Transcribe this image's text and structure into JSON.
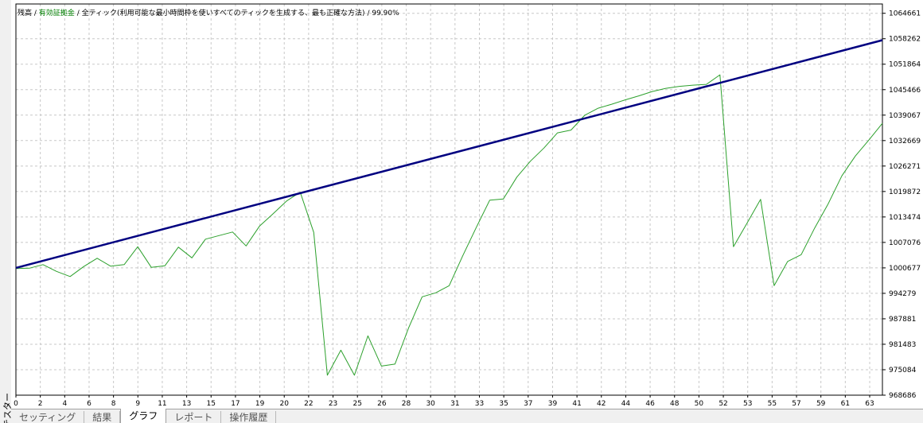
{
  "side_label": "テスター",
  "legend": {
    "balance_label": "残高",
    "separator": " / ",
    "equity_label": "有効証拠金",
    "model_text": "全ティック(利用可能な最小時間枠を使いすべてのティックを生成する、最も正確な方法)",
    "quality_text": "99.90%"
  },
  "tabs": [
    {
      "label": "セッティング"
    },
    {
      "label": "結果"
    },
    {
      "label": "グラフ"
    },
    {
      "label": "レポート"
    },
    {
      "label": "操作履歴"
    }
  ],
  "colors": {
    "balance": "#000080",
    "equity": "#2ca02c",
    "grid": "#c8c8c8",
    "legend_text": "#000000",
    "equity_text": "#008000"
  },
  "chart_data": {
    "type": "line",
    "xlim": [
      0,
      64
    ],
    "ylim": [
      968686,
      1067000
    ],
    "x_ticks": [
      "0",
      "2",
      "4",
      "6",
      "8",
      "9",
      "11",
      "13",
      "15",
      "17",
      "19",
      "20",
      "22",
      "23",
      "25",
      "26",
      "28",
      "30",
      "31",
      "33",
      "35",
      "37",
      "39",
      "41",
      "42",
      "44",
      "46",
      "48",
      "50",
      "52",
      "53",
      "55",
      "57",
      "59",
      "61",
      "63"
    ],
    "y_ticks": [
      1064661,
      1058262,
      1051864,
      1045466,
      1039067,
      1032669,
      1026271,
      1019872,
      1013474,
      1007076,
      1000677,
      994279,
      987881,
      981483,
      975084,
      968686
    ],
    "series": [
      {
        "name": "残高",
        "x": [
          0,
          64
        ],
        "y": [
          1000677,
          1057900
        ]
      },
      {
        "name": "有効証拠金",
        "x": [
          0,
          1,
          2,
          3,
          4,
          5,
          6,
          7,
          8,
          9,
          10,
          11,
          12,
          13,
          14,
          15,
          16,
          17,
          18,
          19,
          20,
          21,
          22,
          23,
          24,
          25,
          26,
          27,
          28,
          29,
          30,
          31,
          32,
          33,
          34,
          35,
          36,
          37,
          38,
          39,
          40,
          41,
          42,
          43,
          44,
          45,
          46,
          47,
          48,
          49,
          50,
          51,
          52,
          53,
          54,
          55,
          56,
          57,
          58,
          59,
          60,
          61,
          62,
          63,
          64
        ],
        "y": [
          1000500,
          1000600,
          1001500,
          999800,
          998500,
          1001000,
          1003100,
          1001100,
          1001500,
          1006000,
          1000800,
          1001200,
          1005900,
          1003200,
          1007900,
          1008800,
          1009700,
          1006200,
          1011200,
          1014300,
          1017500,
          1019700,
          1009600,
          973700,
          980000,
          973700,
          983600,
          976000,
          976500,
          985600,
          993400,
          994400,
          996200,
          1003700,
          1010800,
          1017700,
          1018000,
          1023500,
          1027500,
          1030800,
          1034600,
          1035300,
          1039000,
          1040800,
          1041800,
          1042900,
          1043900,
          1045000,
          1045800,
          1046300,
          1046600,
          1046800,
          1049200,
          1006000,
          1011900,
          1017900,
          996200,
          1002300,
          1004000,
          1010700,
          1016800,
          1023800,
          1028800,
          1032800,
          1037000
        ]
      }
    ]
  }
}
